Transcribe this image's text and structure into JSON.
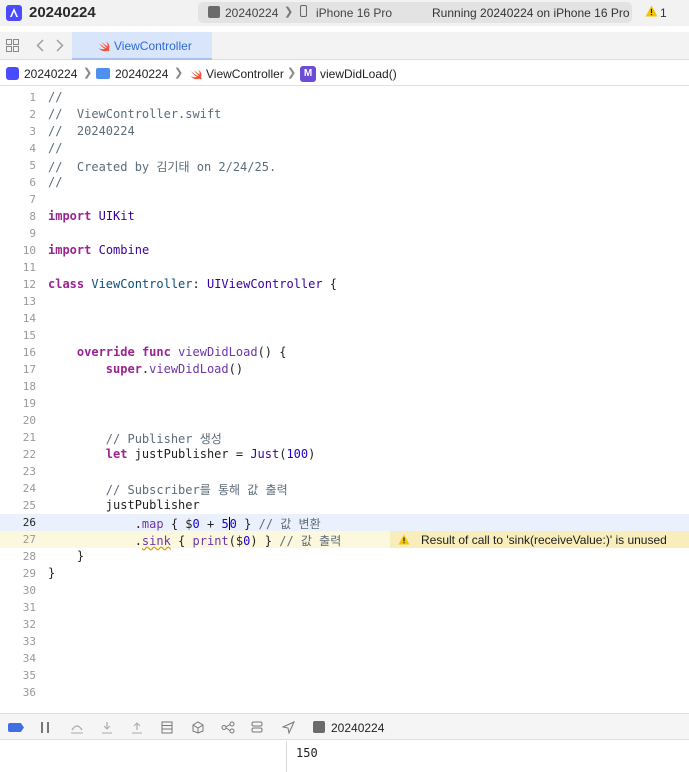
{
  "titlebar": {
    "project_name": "20240224",
    "scheme_app": "20240224",
    "scheme_sep": "❯",
    "scheme_device": "iPhone 16 Pro",
    "run_status": "Running 20240224 on iPhone 16 Pro",
    "warning_count": "1"
  },
  "tab": {
    "label": "ViewController"
  },
  "jumpbar": {
    "items": [
      "20240224",
      "20240224",
      "ViewController",
      "viewDidLoad()"
    ],
    "sep": "❯",
    "method_badge": "M"
  },
  "editor": {
    "current_line": 26,
    "lines": [
      {
        "n": "1",
        "t": "//"
      },
      {
        "n": "2",
        "t": "//  ViewController.swift"
      },
      {
        "n": "3",
        "t": "//  20240224"
      },
      {
        "n": "4",
        "t": "//"
      },
      {
        "n": "5",
        "t": "//  Created by 김기태 on 2/24/25."
      },
      {
        "n": "6",
        "t": "//"
      },
      {
        "n": "7",
        "t": ""
      },
      {
        "n": "8",
        "t": "import UIKit"
      },
      {
        "n": "9",
        "t": ""
      },
      {
        "n": "10",
        "t": "import Combine"
      },
      {
        "n": "11",
        "t": ""
      },
      {
        "n": "12",
        "t": "class ViewController: UIViewController {"
      },
      {
        "n": "13",
        "t": ""
      },
      {
        "n": "14",
        "t": ""
      },
      {
        "n": "15",
        "t": ""
      },
      {
        "n": "16",
        "t": "    override func viewDidLoad() {"
      },
      {
        "n": "17",
        "t": "        super.viewDidLoad()"
      },
      {
        "n": "18",
        "t": ""
      },
      {
        "n": "19",
        "t": ""
      },
      {
        "n": "20",
        "t": ""
      },
      {
        "n": "21",
        "t": "        // Publisher 생성"
      },
      {
        "n": "22",
        "t": "        let justPublisher = Just(100)"
      },
      {
        "n": "23",
        "t": ""
      },
      {
        "n": "24",
        "t": "        // Subscriber를 통해 값 출력"
      },
      {
        "n": "25",
        "t": "        justPublisher"
      },
      {
        "n": "26",
        "t": "            .map { $0 + 50 } // 값 변환"
      },
      {
        "n": "27",
        "t": "            .sink { print($0) } // 값 출력"
      },
      {
        "n": "28",
        "t": "    }"
      },
      {
        "n": "29",
        "t": "}"
      },
      {
        "n": "30",
        "t": ""
      },
      {
        "n": "31",
        "t": ""
      },
      {
        "n": "32",
        "t": ""
      },
      {
        "n": "33",
        "t": ""
      },
      {
        "n": "34",
        "t": ""
      },
      {
        "n": "35",
        "t": ""
      },
      {
        "n": "36",
        "t": ""
      }
    ],
    "warning": {
      "line": 27,
      "message": "Result of call to 'sink(receiveValue:)' is unused"
    }
  },
  "debugbar": {
    "target_label": "20240224"
  },
  "console": {
    "output": "150"
  },
  "colors": {
    "accent": "#3f6fe3",
    "tab_active_bg": "#d9e5fb",
    "current_line_bg": "#ebf1fc",
    "warning_bg": "#f7eebb",
    "keyword": "#9b2393",
    "comment": "#5d6c79"
  }
}
